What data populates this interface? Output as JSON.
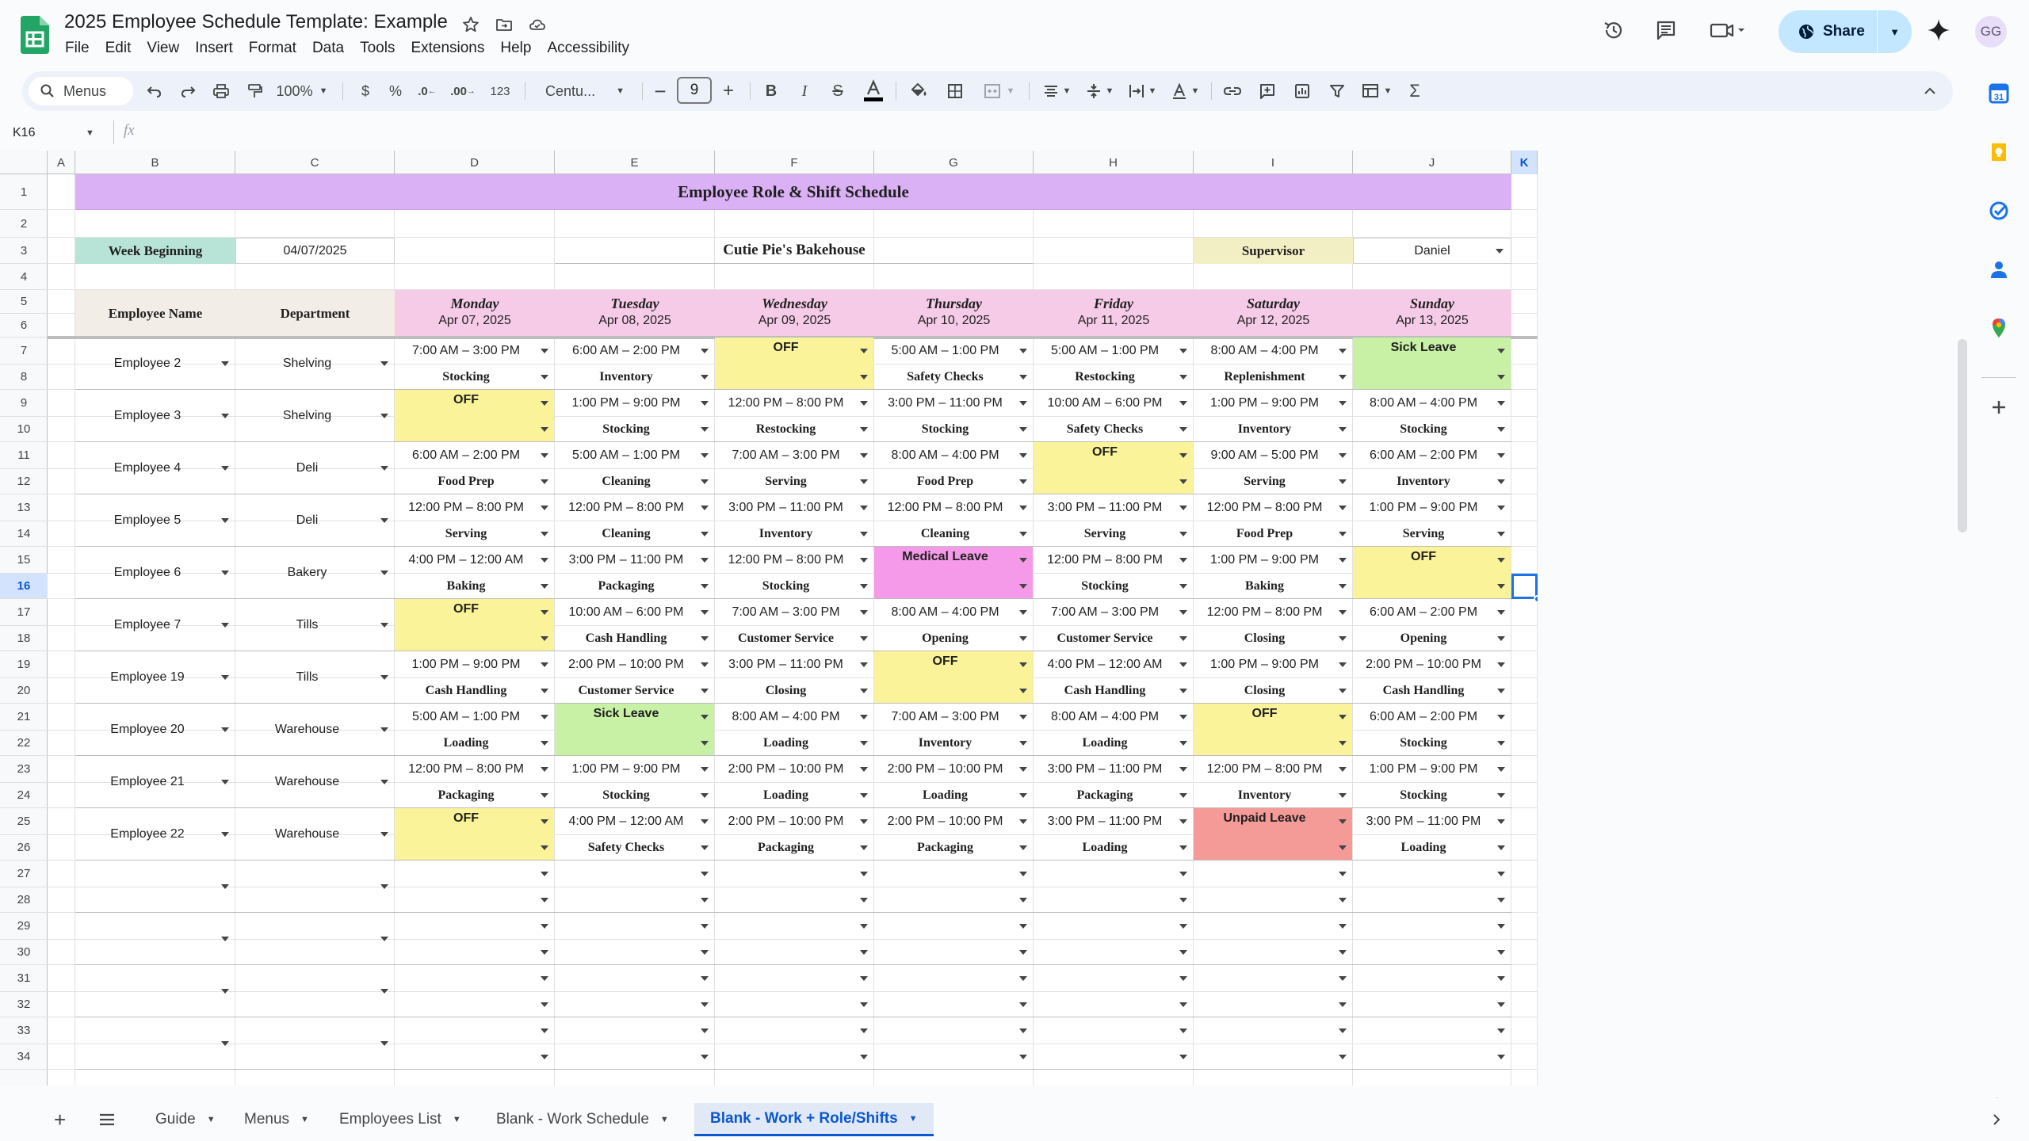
{
  "app": {
    "doc_title": "2025 Employee Schedule Template: Example",
    "menus": [
      "File",
      "Edit",
      "View",
      "Insert",
      "Format",
      "Data",
      "Tools",
      "Extensions",
      "Help",
      "Accessibility"
    ],
    "share_label": "Share",
    "avatar_initials": "GG",
    "accent_color": "#0b57d0",
    "share_color": "#c2e7ff"
  },
  "toolbar": {
    "search_label": "Menus",
    "zoom": "100%",
    "currency": "$",
    "percent": "%",
    "dec_decrease": ".0",
    "dec_increase": ".00",
    "number_format": "123",
    "font": "Centu...",
    "font_size": "9"
  },
  "formula": {
    "name_box": "K16",
    "fx": "fx",
    "value": ""
  },
  "sheet": {
    "columns": [
      "A",
      "B",
      "C",
      "D",
      "E",
      "F",
      "G",
      "H",
      "I",
      "J",
      "K"
    ],
    "rows": [
      "1",
      "2",
      "3",
      "4",
      "5",
      "6",
      "7",
      "8",
      "9",
      "10",
      "11",
      "12",
      "13",
      "14",
      "15",
      "16",
      "17",
      "18",
      "19",
      "20",
      "21",
      "22",
      "23",
      "24",
      "25",
      "26",
      "27",
      "28",
      "29",
      "30",
      "31",
      "32",
      "33",
      "34"
    ],
    "selected_cell": "K16",
    "title": "Employee Role & Shift Schedule",
    "week_label": "Week Beginning",
    "week_value": "04/07/2025",
    "business": "Cutie Pie's Bakehouse",
    "supervisor_label": "Supervisor",
    "supervisor_value": "Daniel",
    "col_employee": "Employee Name",
    "col_department": "Department",
    "days": [
      {
        "name": "Monday",
        "date": "Apr 07, 2025"
      },
      {
        "name": "Tuesday",
        "date": "Apr 08, 2025"
      },
      {
        "name": "Wednesday",
        "date": "Apr 09, 2025"
      },
      {
        "name": "Thursday",
        "date": "Apr 10, 2025"
      },
      {
        "name": "Friday",
        "date": "Apr 11, 2025"
      },
      {
        "name": "Saturday",
        "date": "Apr 12, 2025"
      },
      {
        "name": "Sunday",
        "date": "Apr 13, 2025"
      }
    ],
    "colors": {
      "title_bg": "#dab1f5",
      "day_bg": "#f6cbe8",
      "week_bg": "#b7e4d6",
      "supervisor_bg": "#f3efc4",
      "header_bg": "#f2ede6",
      "off": "#fbf39a",
      "sick": "#c8f1a6",
      "medical": "#f59ae8",
      "unpaid": "#f49a97"
    },
    "employees": [
      {
        "name": "Employee 2",
        "dept": "Shelving",
        "shifts": [
          {
            "time": "7:00 AM – 3:00 PM",
            "role": "Stocking"
          },
          {
            "time": "6:00 AM – 2:00 PM",
            "role": "Inventory"
          },
          {
            "time": "OFF",
            "role": "",
            "status": "off"
          },
          {
            "time": "5:00 AM – 1:00 PM",
            "role": "Safety Checks"
          },
          {
            "time": "5:00 AM – 1:00 PM",
            "role": "Restocking"
          },
          {
            "time": "8:00 AM – 4:00 PM",
            "role": "Replenishment"
          },
          {
            "time": "Sick Leave",
            "role": "",
            "status": "sick"
          }
        ]
      },
      {
        "name": "Employee 3",
        "dept": "Shelving",
        "shifts": [
          {
            "time": "OFF",
            "role": "",
            "status": "off"
          },
          {
            "time": "1:00 PM – 9:00 PM",
            "role": "Stocking"
          },
          {
            "time": "12:00 PM – 8:00 PM",
            "role": "Restocking"
          },
          {
            "time": "3:00 PM – 11:00 PM",
            "role": "Stocking"
          },
          {
            "time": "10:00 AM – 6:00 PM",
            "role": "Safety Checks"
          },
          {
            "time": "1:00 PM – 9:00 PM",
            "role": "Inventory"
          },
          {
            "time": "8:00 AM – 4:00 PM",
            "role": "Stocking"
          }
        ]
      },
      {
        "name": "Employee 4",
        "dept": "Deli",
        "shifts": [
          {
            "time": "6:00 AM – 2:00 PM",
            "role": "Food Prep"
          },
          {
            "time": "5:00 AM – 1:00 PM",
            "role": "Cleaning"
          },
          {
            "time": "7:00 AM – 3:00 PM",
            "role": "Serving"
          },
          {
            "time": "8:00 AM – 4:00 PM",
            "role": "Food Prep"
          },
          {
            "time": "OFF",
            "role": "",
            "status": "off"
          },
          {
            "time": "9:00 AM – 5:00 PM",
            "role": "Serving"
          },
          {
            "time": "6:00 AM – 2:00 PM",
            "role": "Inventory"
          }
        ]
      },
      {
        "name": "Employee 5",
        "dept": "Deli",
        "shifts": [
          {
            "time": "12:00 PM – 8:00 PM",
            "role": "Serving"
          },
          {
            "time": "12:00 PM – 8:00 PM",
            "role": "Cleaning"
          },
          {
            "time": "3:00 PM – 11:00 PM",
            "role": "Inventory"
          },
          {
            "time": "12:00 PM – 8:00 PM",
            "role": "Cleaning"
          },
          {
            "time": "3:00 PM – 11:00 PM",
            "role": "Serving"
          },
          {
            "time": "12:00 PM – 8:00 PM",
            "role": "Food Prep"
          },
          {
            "time": "1:00 PM – 9:00 PM",
            "role": "Serving"
          }
        ]
      },
      {
        "name": "Employee 6",
        "dept": "Bakery",
        "shifts": [
          {
            "time": "4:00 PM – 12:00 AM",
            "role": "Baking"
          },
          {
            "time": "3:00 PM – 11:00 PM",
            "role": "Packaging"
          },
          {
            "time": "12:00 PM – 8:00 PM",
            "role": "Stocking"
          },
          {
            "time": "Medical Leave",
            "role": "",
            "status": "medical"
          },
          {
            "time": "12:00 PM – 8:00 PM",
            "role": "Stocking"
          },
          {
            "time": "1:00 PM – 9:00 PM",
            "role": "Baking"
          },
          {
            "time": "OFF",
            "role": "",
            "status": "off"
          }
        ]
      },
      {
        "name": "Employee 7",
        "dept": "Tills",
        "shifts": [
          {
            "time": "OFF",
            "role": "",
            "status": "off"
          },
          {
            "time": "10:00 AM – 6:00 PM",
            "role": "Cash Handling"
          },
          {
            "time": "7:00 AM – 3:00 PM",
            "role": "Customer Service"
          },
          {
            "time": "8:00 AM – 4:00 PM",
            "role": "Opening"
          },
          {
            "time": "7:00 AM – 3:00 PM",
            "role": "Customer Service"
          },
          {
            "time": "12:00 PM – 8:00 PM",
            "role": "Closing"
          },
          {
            "time": "6:00 AM – 2:00 PM",
            "role": "Opening"
          }
        ]
      },
      {
        "name": "Employee 19",
        "dept": "Tills",
        "shifts": [
          {
            "time": "1:00 PM – 9:00 PM",
            "role": "Cash Handling"
          },
          {
            "time": "2:00 PM – 10:00 PM",
            "role": "Customer Service"
          },
          {
            "time": "3:00 PM – 11:00 PM",
            "role": "Closing"
          },
          {
            "time": "OFF",
            "role": "",
            "status": "off"
          },
          {
            "time": "4:00 PM – 12:00 AM",
            "role": "Cash Handling"
          },
          {
            "time": "1:00 PM – 9:00 PM",
            "role": "Closing"
          },
          {
            "time": "2:00 PM – 10:00 PM",
            "role": "Cash Handling"
          }
        ]
      },
      {
        "name": "Employee 20",
        "dept": "Warehouse",
        "shifts": [
          {
            "time": "5:00 AM – 1:00 PM",
            "role": "Loading"
          },
          {
            "time": "Sick Leave",
            "role": "",
            "status": "sick"
          },
          {
            "time": "8:00 AM – 4:00 PM",
            "role": "Loading"
          },
          {
            "time": "7:00 AM – 3:00 PM",
            "role": "Inventory"
          },
          {
            "time": "8:00 AM – 4:00 PM",
            "role": "Loading"
          },
          {
            "time": "OFF",
            "role": "",
            "status": "off"
          },
          {
            "time": "6:00 AM – 2:00 PM",
            "role": "Stocking"
          }
        ]
      },
      {
        "name": "Employee 21",
        "dept": "Warehouse",
        "shifts": [
          {
            "time": "12:00 PM – 8:00 PM",
            "role": "Packaging"
          },
          {
            "time": "1:00 PM – 9:00 PM",
            "role": "Stocking"
          },
          {
            "time": "2:00 PM – 10:00 PM",
            "role": "Loading"
          },
          {
            "time": "2:00 PM – 10:00 PM",
            "role": "Loading"
          },
          {
            "time": "3:00 PM – 11:00 PM",
            "role": "Packaging"
          },
          {
            "time": "12:00 PM – 8:00 PM",
            "role": "Inventory"
          },
          {
            "time": "1:00 PM – 9:00 PM",
            "role": "Stocking"
          }
        ]
      },
      {
        "name": "Employee 22",
        "dept": "Warehouse",
        "shifts": [
          {
            "time": "OFF",
            "role": "",
            "status": "off"
          },
          {
            "time": "4:00 PM – 12:00 AM",
            "role": "Safety Checks"
          },
          {
            "time": "2:00 PM – 10:00 PM",
            "role": "Packaging"
          },
          {
            "time": "2:00 PM – 10:00 PM",
            "role": "Packaging"
          },
          {
            "time": "3:00 PM – 11:00 PM",
            "role": "Loading"
          },
          {
            "time": "Unpaid Leave",
            "role": "",
            "status": "unpaid"
          },
          {
            "time": "3:00 PM – 11:00 PM",
            "role": "Loading"
          }
        ]
      }
    ],
    "empty_blocks": 4
  },
  "tabs": {
    "items": [
      "Guide",
      "Menus",
      "Employees List",
      "Blank - Work Schedule",
      "Blank - Work + Role/Shifts"
    ],
    "active": "Blank - Work + Role/Shifts"
  }
}
